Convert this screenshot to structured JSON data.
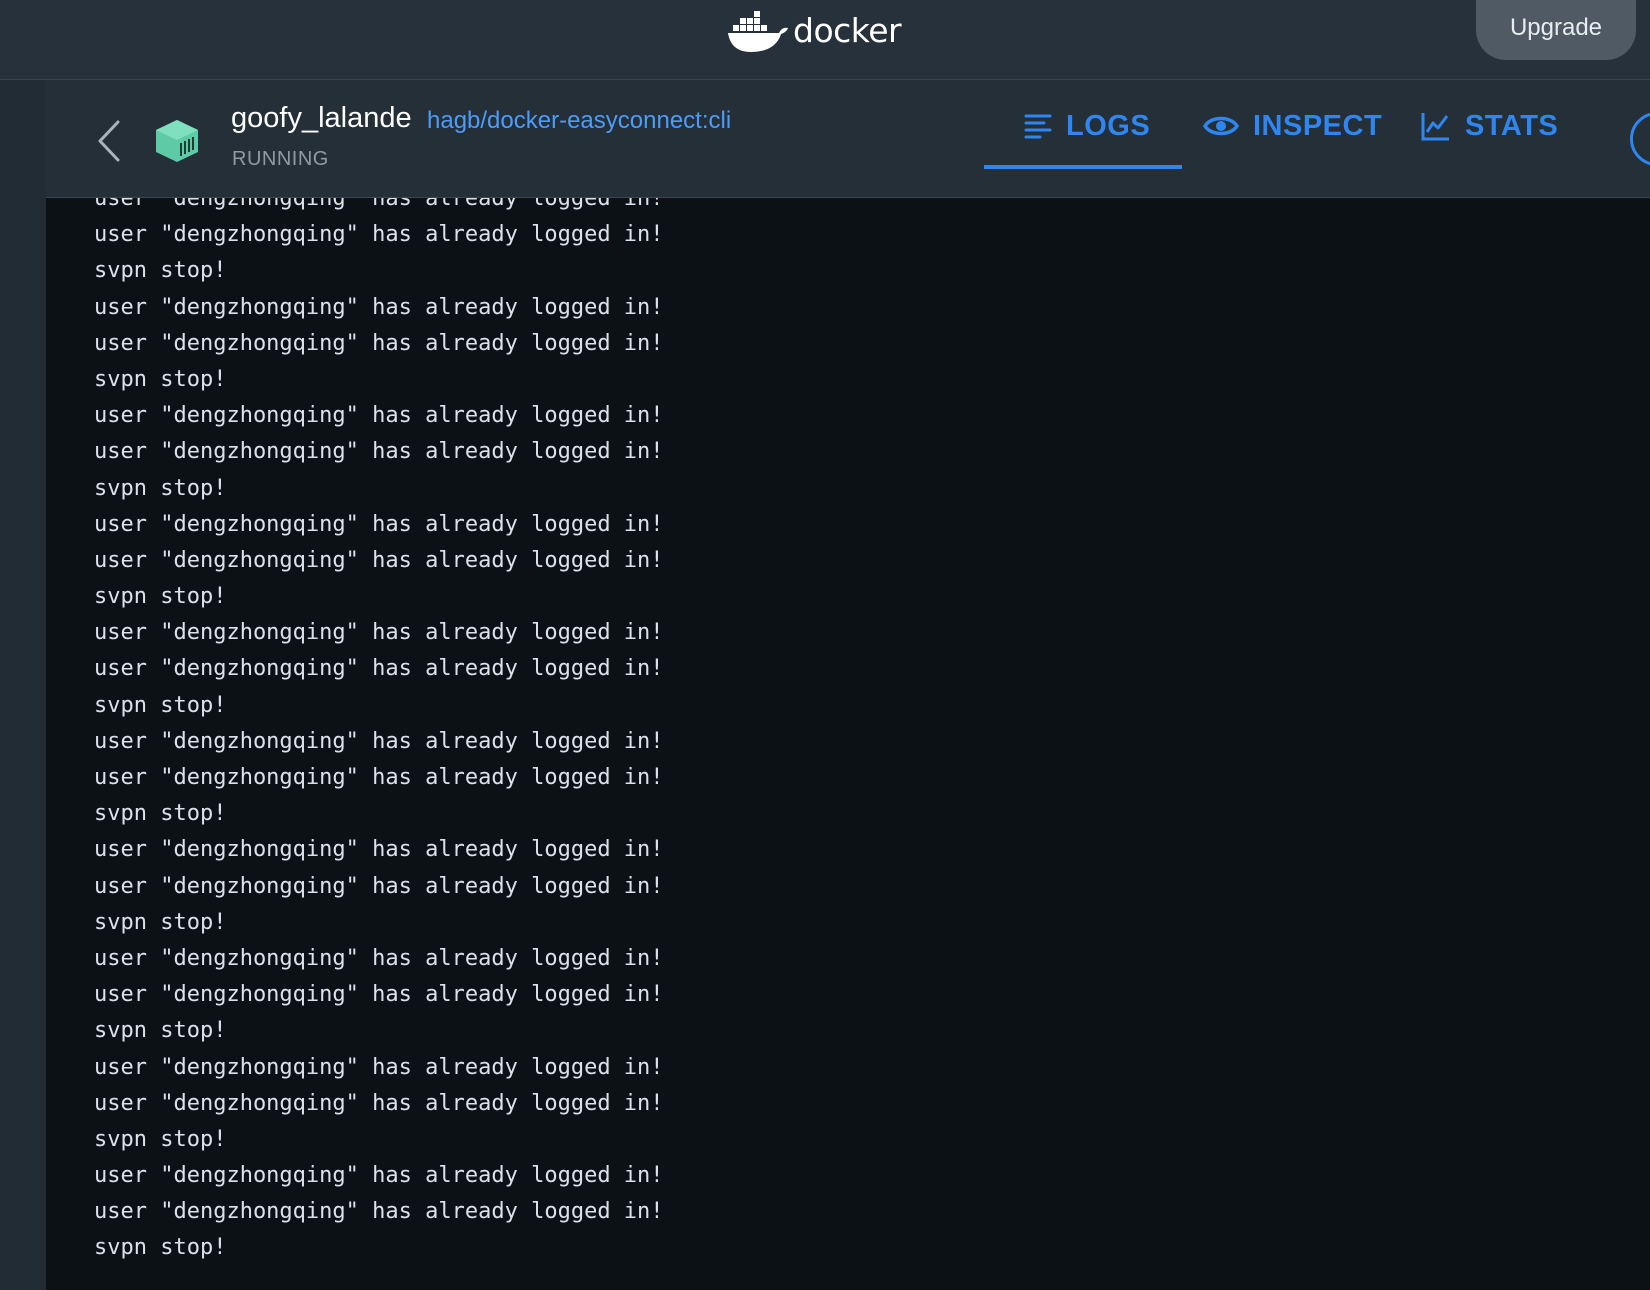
{
  "topbar": {
    "brand": "docker",
    "upgrade_label": "Upgrade"
  },
  "container": {
    "name": "goofy_lalande",
    "image": "hagb/docker-easyconnect:cli",
    "status": "RUNNING"
  },
  "tabs": [
    {
      "label": "LOGS",
      "icon": "lines-icon",
      "active": true
    },
    {
      "label": "INSPECT",
      "icon": "eye-icon",
      "active": false
    },
    {
      "label": "STATS",
      "icon": "chart-icon",
      "active": false
    }
  ],
  "colors": {
    "accent": "#2f86f0",
    "link": "#4d9cf8",
    "container_icon": "#5ecaa6",
    "topbar_bg": "#27313b",
    "log_bg": "#0c1116"
  },
  "logs": [
    "user \"dengzhongqing\" has already logged in!",
    "user \"dengzhongqing\" has already logged in!",
    "svpn stop!",
    "user \"dengzhongqing\" has already logged in!",
    "user \"dengzhongqing\" has already logged in!",
    "svpn stop!",
    "user \"dengzhongqing\" has already logged in!",
    "user \"dengzhongqing\" has already logged in!",
    "svpn stop!",
    "user \"dengzhongqing\" has already logged in!",
    "user \"dengzhongqing\" has already logged in!",
    "svpn stop!",
    "user \"dengzhongqing\" has already logged in!",
    "user \"dengzhongqing\" has already logged in!",
    "svpn stop!",
    "user \"dengzhongqing\" has already logged in!",
    "user \"dengzhongqing\" has already logged in!",
    "svpn stop!",
    "user \"dengzhongqing\" has already logged in!",
    "user \"dengzhongqing\" has already logged in!",
    "svpn stop!",
    "user \"dengzhongqing\" has already logged in!",
    "user \"dengzhongqing\" has already logged in!",
    "svpn stop!",
    "user \"dengzhongqing\" has already logged in!",
    "user \"dengzhongqing\" has already logged in!",
    "svpn stop!",
    "user \"dengzhongqing\" has already logged in!",
    "user \"dengzhongqing\" has already logged in!",
    "svpn stop!"
  ]
}
